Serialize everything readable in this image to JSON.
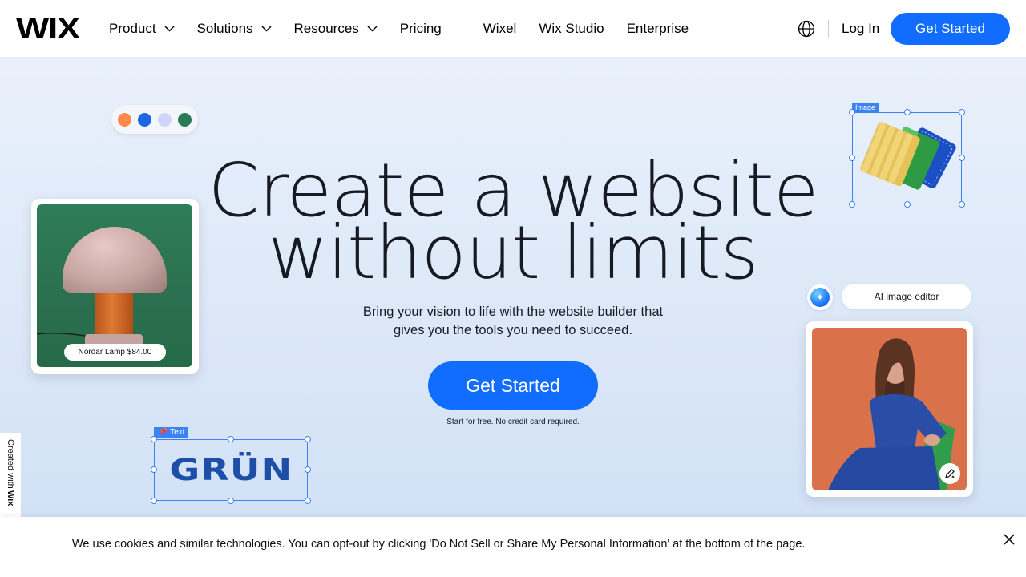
{
  "header": {
    "logo": "WIX",
    "nav": [
      {
        "label": "Product",
        "dropdown": true
      },
      {
        "label": "Solutions",
        "dropdown": true
      },
      {
        "label": "Resources",
        "dropdown": true
      },
      {
        "label": "Pricing",
        "dropdown": false
      }
    ],
    "nav_secondary": [
      "Wixel",
      "Wix Studio",
      "Enterprise"
    ],
    "language_icon": "globe-icon",
    "login_label": "Log In",
    "cta_label": "Get Started"
  },
  "hero": {
    "title_line1": "Create a website",
    "title_line2": "without limits",
    "subtitle": "Bring your vision to life with the website builder that gives you the tools you need to succeed.",
    "cta_label": "Get Started",
    "note": "Start for free. No credit card required."
  },
  "decor": {
    "palette": [
      "#ff8a4c",
      "#1e66e0",
      "#d3d4fb",
      "#2a7a54"
    ],
    "product_tag": "Nordar Lamp $84.00",
    "image_label": "Image",
    "ai_label": "AI image editor",
    "text_label": "Text",
    "brand_word": "GRÜN"
  },
  "side_tab": {
    "prefix": "Created with",
    "brand": "Wix"
  },
  "cookie": {
    "message": "We use cookies and similar technologies. You can opt-out by clicking 'Do Not Sell or Share My Personal Information' at the bottom of the page.",
    "close_icon": "close-icon"
  },
  "colors": {
    "accent": "#116dff",
    "selection": "#3b82f6",
    "text": "#161a22"
  }
}
